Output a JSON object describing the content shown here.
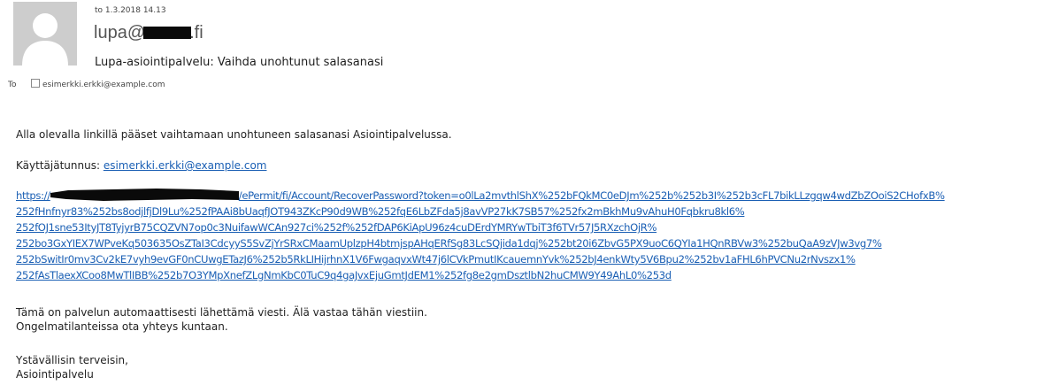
{
  "header": {
    "date": "to 1.3.2018 14.13",
    "sender_prefix": "lupa@",
    "sender_suffix": ".fi",
    "subject": "Lupa-asiointipalvelu: Vaihda unohtunut salasanasi",
    "to_label": "To",
    "to_address": "esimerkki.erkki@example.com",
    "avatar_icon": "person-placeholder-icon"
  },
  "body": {
    "intro": "Alla olevalla linkillä pääset vaihtamaan unohtuneen salasanasi Asiointipalvelussa.",
    "username_label": "Käyttäjätunnus: ",
    "username_value": "esimerkki.erkki@example.com",
    "link_lines": [
      "https://",
      "/ePermit/fi/Account/RecoverPassword?token=o0lLa2mvthlShX%252bFQkMC0eDJm%252b%252b3I%252b3cFL7bikLLzgqw4wdZbZOoiS2CHofxB%",
      "252fHnfnyr83%252bs8odjlfjDl9Lu%252fPAAi8bUaqfJOT943ZKcP90d9WB%252fqE6LbZFda5j8avVP27kK7SB57%252fx2mBkhMu9vAhuH0Fqbkru8kl6%",
      "252fOJ1sne53ItyJT8TyjyrB75CQZVN7op0c3NuifawWCAn927ci%252f%252fDAP6KiApU96z4cuDErdYMRYwTbiT3f6TVr57J5RXzchOjR%",
      "252bo3GxYIEX7WPveKq503635OsZTaI3CdcyyS5SvZjYrSRxCMaamUplzpH4btmjspAHqERfSg83LcSQjida1dqj%252bt20i6ZbvG5PX9uoC6QYIa1HQnRBVw3%252buQaA9zVJw3vg7%",
      "252bSwitIr0mv3Cv2kE7vyh9evGF0nCUwgETazJ6%252b5RkLIHijrhnX1V6FwgaqvxWt47j6lCVkPmutIKcauemnYvk%252bJ4enkWty5V6Bpu2%252bv1aFHL6hPVCNu2rNvszx1%",
      "252fAsTlaexXCoo8MwTlIBB%252b7O3YMpXnefZLgNmKbC0TuC9q4gaJvxEjuGmtJdEM1%252fg8e2gmDsztlbN2huCMW9Y49AhL0%253d"
    ],
    "auto_notice": "Tämä on palvelun automaattisesti lähettämä viesti. Älä vastaa tähän viestiin.",
    "contact_notice": "Ongelmatilanteissa ota yhteys kuntaan.",
    "greeting": "Ystävällisin terveisin,",
    "signature": "Asiointipalvelu"
  },
  "colors": {
    "link": "#1a5fb4",
    "avatar_bg": "#cdcdcd",
    "redaction": "#0a0a0a"
  }
}
